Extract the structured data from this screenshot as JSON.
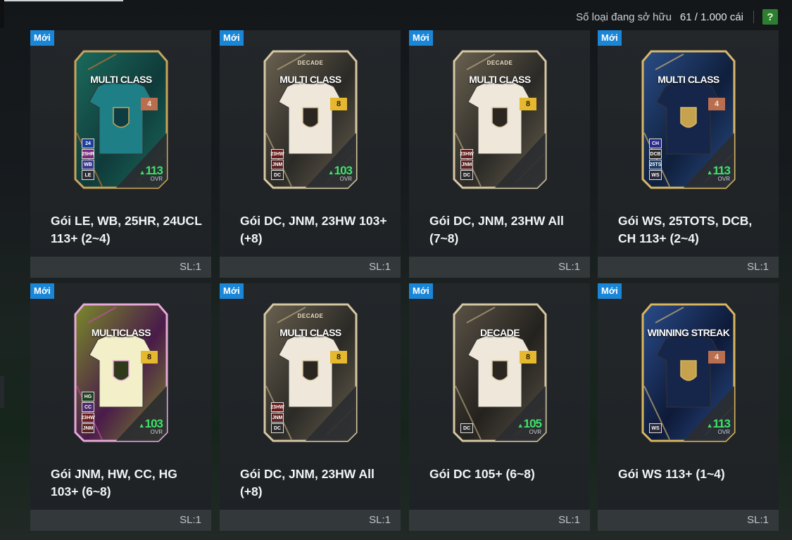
{
  "topbar": {
    "label": "Số loại đang sở hữu",
    "count": "61 / 1.000 cái",
    "help": "?"
  },
  "colors": {
    "badge": "#1a86d8",
    "ovr": "#3fe26a",
    "help": "#2f7d31"
  },
  "tiles": [
    {
      "badge": "Mới",
      "title": "MULTI CLASS",
      "subtitle": "",
      "level": "4",
      "tags": [
        "24",
        "25HR",
        "WB",
        "LE"
      ],
      "ovr": "113",
      "ovr_label": "OVR",
      "name": "Gói LE, WB, 25HR, 24UCL 113+ (2~4)",
      "qty": "SL:1"
    },
    {
      "badge": "Mới",
      "title": "MULTI CLASS",
      "subtitle": "DECADE",
      "level": "8",
      "tags": [
        "23HW",
        "JNM",
        "DC"
      ],
      "ovr": "103",
      "ovr_label": "OVR",
      "name": "Gói DC, JNM, 23HW 103+ (+8)",
      "qty": "SL:1"
    },
    {
      "badge": "Mới",
      "title": "MULTI CLASS",
      "subtitle": "DECADE",
      "level": "8",
      "tags": [
        "23HW",
        "JNM",
        "DC"
      ],
      "ovr": "",
      "ovr_label": "",
      "name": "Gói DC, JNM, 23HW All (7~8)",
      "qty": "SL:1"
    },
    {
      "badge": "Mới",
      "title": "MULTI CLASS",
      "subtitle": "",
      "level": "4",
      "tags": [
        "CH",
        "DCB",
        "25TS",
        "WS"
      ],
      "ovr": "113",
      "ovr_label": "OVR",
      "name": "Gói WS, 25TOTS, DCB, CH 113+ (2~4)",
      "qty": "SL:1"
    },
    {
      "badge": "Mới",
      "title": "MULTICLASS",
      "subtitle": "",
      "level": "8",
      "tags": [
        "HG",
        "CC",
        "23HW",
        "JNM"
      ],
      "ovr": "103",
      "ovr_label": "OVR",
      "name": "Gói JNM, HW, CC, HG 103+ (6~8)",
      "qty": "SL:1"
    },
    {
      "badge": "Mới",
      "title": "MULTI CLASS",
      "subtitle": "DECADE",
      "level": "8",
      "tags": [
        "23HW",
        "JNM",
        "DC"
      ],
      "ovr": "",
      "ovr_label": "",
      "name": "Gói DC, JNM, 23HW All (+8)",
      "qty": "SL:1"
    },
    {
      "badge": "Mới",
      "title": "DECADE",
      "subtitle": "",
      "level": "8",
      "tags": [
        "DC"
      ],
      "ovr": "105",
      "ovr_label": "OVR",
      "name": "Gói DC 105+ (6~8)",
      "qty": "SL:1"
    },
    {
      "badge": "Mới",
      "title": "WINNING STREAK",
      "subtitle": "",
      "level": "4",
      "tags": [
        "WS"
      ],
      "ovr": "113",
      "ovr_label": "OVR",
      "name": "Gói WS 113+ (1~4)",
      "qty": "SL:1"
    }
  ]
}
